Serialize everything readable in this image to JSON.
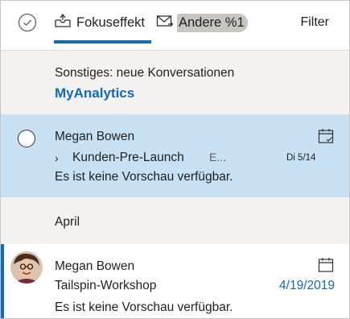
{
  "header": {
    "tab_focused": "Fokuseffekt",
    "tab_other": "Andere %1",
    "filter": "Filter"
  },
  "notice": {
    "text": "Sonstiges: neue Konversationen",
    "link": "MyAnalytics"
  },
  "messages": [
    {
      "sender": "Megan Bowen",
      "thread": "Kunden-Pre-Launch",
      "thread_extra": "E...",
      "date": "Di 5/14",
      "preview": "Es ist keine Vorschau verfügbar.",
      "selected": true
    },
    {
      "sender": "Megan Bowen",
      "subject": "Tailspin-Workshop",
      "date": "4/19/2019",
      "preview": "Es ist keine Vorschau verfügbar.",
      "unread": true
    }
  ],
  "group": {
    "label": "April"
  },
  "colors": {
    "accent": "#0f6cbd",
    "selected_row": "#c7e0f4",
    "section_bg": "#f3f2f1"
  }
}
